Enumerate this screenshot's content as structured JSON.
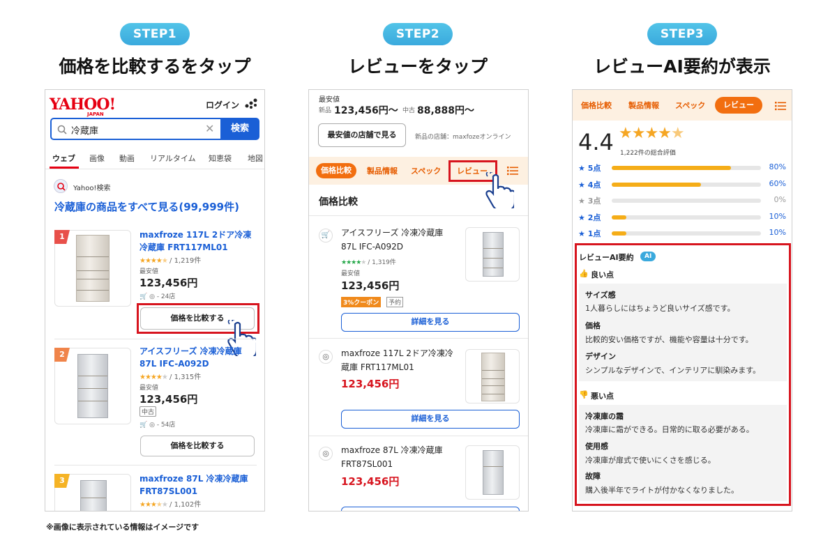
{
  "steps": [
    {
      "label": "STEP1",
      "title": "価格を比較するをタップ"
    },
    {
      "label": "STEP2",
      "title": "レビューをタップ"
    },
    {
      "label": "STEP3",
      "title": "レビューAI要約が表示"
    }
  ],
  "footnote": "※画像に表示されている情報はイメージです",
  "colors": {
    "accent_red": "#d7141e",
    "brand_blue": "#1a5fd6",
    "orange": "#f26e0f",
    "star": "#f5a623"
  },
  "p1": {
    "logo_main": "YAHOO!",
    "logo_sub": "JAPAN",
    "login": "ログイン",
    "search_value": "冷蔵庫",
    "search_button": "検索",
    "tabs": [
      "ウェブ",
      "画像",
      "動画",
      "リアルタイム",
      "知恵袋",
      "地図"
    ],
    "source": "Yahoo!検索",
    "see_all": "冷蔵庫の商品をすべて見る(99,999件)",
    "products": [
      {
        "rank": "1",
        "name": "maxfroze 117L 2ドア冷凍冷蔵庫 FRT117ML01",
        "rating": 4.5,
        "count": "/ 1,219件",
        "price_label": "最安値",
        "price": "123,456円",
        "shops": "- 24店",
        "cta": "価格を比較する"
      },
      {
        "rank": "2",
        "name": "アイスフリーズ 冷凍冷蔵庫 87L IFC-A092D",
        "rating": 4.0,
        "count": "/ 1,315件",
        "price_label": "最安値",
        "price": "123,456円",
        "badge": "中古",
        "shops": "- 54店",
        "cta": "価格を比較する"
      },
      {
        "rank": "3",
        "name": "maxfroze 87L 冷凍冷蔵庫 FRT87SL001",
        "rating": 3.5,
        "count": "/ 1,102件"
      }
    ]
  },
  "p2": {
    "lowest_label": "最安値",
    "new_label": "新品",
    "new_price": "123,456円〜",
    "used_label": "中古",
    "used_price": "88,888円〜",
    "shop_button": "最安値の店舗で見る",
    "shop_note": "新品の店舗：maxfozeオンライン",
    "tabs": [
      "価格比較",
      "製品情報",
      "スペック",
      "レビュー"
    ],
    "section": "価格比較",
    "items": [
      {
        "name": "アイスフリーズ 冷凍冷蔵庫 87L IFC-A092D",
        "rating": 4.0,
        "count": "/ 1,319件",
        "price_label": "最安値",
        "price": "123,456円",
        "coupon": "3%クーポン",
        "reserve": "予約",
        "cta": "詳細を見る"
      },
      {
        "name": "maxfroze 117L 2ドア冷凍冷蔵庫 FRT117ML01",
        "price": "123,456円",
        "cta": "詳細を見る"
      },
      {
        "name": "maxfroze 87L 冷凍冷蔵庫 FRT87SL001",
        "price": "123,456円"
      }
    ]
  },
  "p3": {
    "tabs": [
      "価格比較",
      "製品情報",
      "スペック",
      "レビュー"
    ],
    "score": "4.4",
    "score_value": 4.4,
    "total": "1,222件の総合評価",
    "bars": [
      {
        "label": "★ 5点",
        "pct": "80%",
        "value": 80
      },
      {
        "label": "★ 4点",
        "pct": "60%",
        "value": 60
      },
      {
        "label": "★ 3点",
        "pct": "0%",
        "value": 0
      },
      {
        "label": "★ 2点",
        "pct": "10%",
        "value": 10
      },
      {
        "label": "★ 1点",
        "pct": "10%",
        "value": 10
      }
    ],
    "ai_title": "レビューAI要約",
    "ai_badge": "AI",
    "good_heading": "良い点",
    "good": [
      {
        "title": "サイズ感",
        "text": "1人暮らしにはちょうど良いサイズ感です。"
      },
      {
        "title": "価格",
        "text": "比較的安い価格ですが、機能や容量は十分です。"
      },
      {
        "title": "デザイン",
        "text": "シンプルなデザインで、インテリアに馴染みます。"
      }
    ],
    "bad_heading": "悪い点",
    "bad": [
      {
        "title": "冷凍庫の霜",
        "text": "冷凍庫に霜ができる。日常的に取る必要がある。"
      },
      {
        "title": "使用感",
        "text": "冷凍庫が扉式で使いにくさを感じる。"
      },
      {
        "title": "故障",
        "text": "購入後半年でライトが付かなくなりました。"
      }
    ]
  }
}
